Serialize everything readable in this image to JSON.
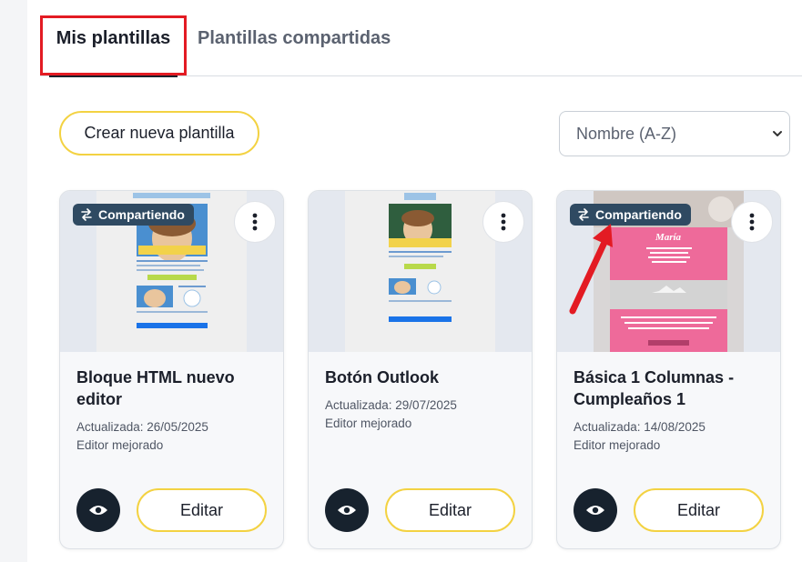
{
  "tabs": {
    "active_label": "Mis plantillas",
    "inactive_label": "Plantillas compartidas"
  },
  "toolbar": {
    "create_label": "Crear nueva plantilla",
    "sort_value": "Nombre (A-Z)"
  },
  "cards": [
    {
      "title": "Bloque HTML nuevo editor",
      "updated": "Actualizada: 26/05/2025",
      "editor": "Editor mejorado",
      "badge": "Compartiendo",
      "edit_label": "Editar"
    },
    {
      "title": "Botón Outlook",
      "updated": "Actualizada: 29/07/2025",
      "editor": "Editor mejorado",
      "edit_label": "Editar"
    },
    {
      "title": "Básica 1 Columnas - Cumpleaños 1",
      "updated": "Actualizada: 14/08/2025",
      "editor": "Editor mejorado",
      "badge": "Compartiendo",
      "edit_label": "Editar",
      "thumb_heading": "María"
    }
  ],
  "colors": {
    "accent_yellow": "#f3d242",
    "badge_bg": "#2f4a62",
    "highlight_red": "#e31b23",
    "eye_bg": "#17222e"
  },
  "icons": [
    "share-arrows-icon",
    "more-vertical-icon",
    "eye-icon",
    "chevron-down-icon"
  ]
}
